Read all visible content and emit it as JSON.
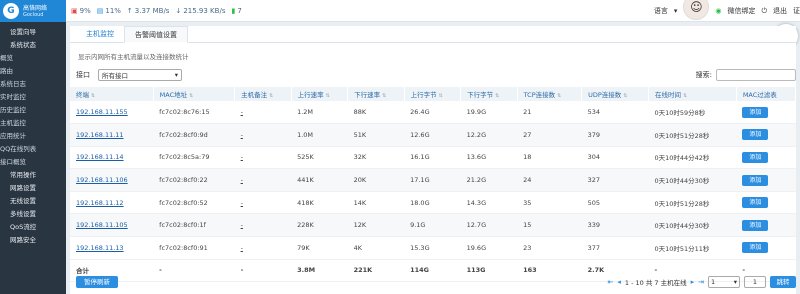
{
  "logo": {
    "cn": "高恪网络",
    "en": "Gocloud"
  },
  "sidebar": {
    "sections": [
      {
        "label": "设置向导",
        "items": []
      },
      {
        "label": "系统状态",
        "items": [
          "概览",
          "路由",
          "系统日志",
          "实时监控",
          "历史监控",
          "主机监控",
          "应用统计",
          "QQ在线列表",
          "接口概览"
        ]
      },
      {
        "label": "常用操作",
        "items": []
      },
      {
        "label": "网路设置",
        "items": []
      },
      {
        "label": "无线设置",
        "items": []
      },
      {
        "label": "多线设置",
        "items": []
      },
      {
        "label": "QoS流控",
        "items": []
      },
      {
        "label": "网路安全",
        "items": []
      }
    ]
  },
  "topbar": {
    "cpu": "9%",
    "mem": "11%",
    "up": "3.37 MB/s",
    "down": "215.93 KB/s",
    "count": "7",
    "lang": "语言",
    "wechat": "微信绑定",
    "logout": "退出",
    "more": "证"
  },
  "tabs": [
    "主机监控",
    "告警阈值设置"
  ],
  "description": "显示内网所有主机流量以及连接数统计",
  "filter": {
    "label": "接口",
    "selected": "所有接口",
    "search_label": "搜索:",
    "search_placeholder": ""
  },
  "table": {
    "headers": [
      "终端",
      "MAC地址",
      "主机备注",
      "上行速率",
      "下行速率",
      "上行字节",
      "下行字节",
      "TCP连接数",
      "UDP连接数",
      "在线时间",
      "MAC过滤表"
    ],
    "rows": [
      {
        "ip": "192.168.11.155",
        "mac": "fc7c02:8c76:15",
        "note": "-",
        "up": "1.2M",
        "down": "88K",
        "upb": "26.4G",
        "downb": "19.9G",
        "tcp": "21",
        "udp": "534",
        "time": "0天10时59分8秒",
        "btn": "添加"
      },
      {
        "ip": "192.168.11.11",
        "mac": "fc7c02:8cf0:9d",
        "note": "-",
        "up": "1.0M",
        "down": "51K",
        "upb": "12.6G",
        "downb": "12.2G",
        "tcp": "27",
        "udp": "379",
        "time": "0天10时51分28秒",
        "btn": "添加"
      },
      {
        "ip": "192.168.11.14",
        "mac": "fc7c02:8c5a:79",
        "note": "-",
        "up": "525K",
        "down": "32K",
        "upb": "16.1G",
        "downb": "13.6G",
        "tcp": "18",
        "udp": "304",
        "time": "0天10时44分42秒",
        "btn": "添加"
      },
      {
        "ip": "192.168.11.106",
        "mac": "fc7c02:8cf0:22",
        "note": "-",
        "up": "441K",
        "down": "20K",
        "upb": "17.1G",
        "downb": "21.2G",
        "tcp": "24",
        "udp": "327",
        "time": "0天10时44分30秒",
        "btn": "添加"
      },
      {
        "ip": "192.168.11.12",
        "mac": "fc7c02:8cf0:52",
        "note": "-",
        "up": "418K",
        "down": "14K",
        "upb": "18.0G",
        "downb": "14.3G",
        "tcp": "35",
        "udp": "505",
        "time": "0天10时51分28秒",
        "btn": "添加"
      },
      {
        "ip": "192.168.11.105",
        "mac": "fc7c02:8cf0:1f",
        "note": "-",
        "up": "228K",
        "down": "12K",
        "upb": "9.1G",
        "downb": "12.7G",
        "tcp": "15",
        "udp": "339",
        "time": "0天10时44分30秒",
        "btn": "添加"
      },
      {
        "ip": "192.168.11.13",
        "mac": "fc7c02:8cf0:91",
        "note": "-",
        "up": "79K",
        "down": "4K",
        "upb": "15.3G",
        "downb": "19.6G",
        "tcp": "23",
        "udp": "377",
        "time": "0天10时51分11秒",
        "btn": "添加"
      }
    ],
    "total": {
      "label": "合计",
      "mac": "-",
      "note": "-",
      "up": "3.8M",
      "down": "221K",
      "upb": "114G",
      "downb": "113G",
      "tcp": "163",
      "udp": "2.7K",
      "time": "-",
      "btn": "-"
    }
  },
  "footer": {
    "pause": "暂停刷新",
    "info": "1 - 10 共 7 主机在线",
    "page_size": "1",
    "page_input": "1",
    "jump": "跳转"
  }
}
